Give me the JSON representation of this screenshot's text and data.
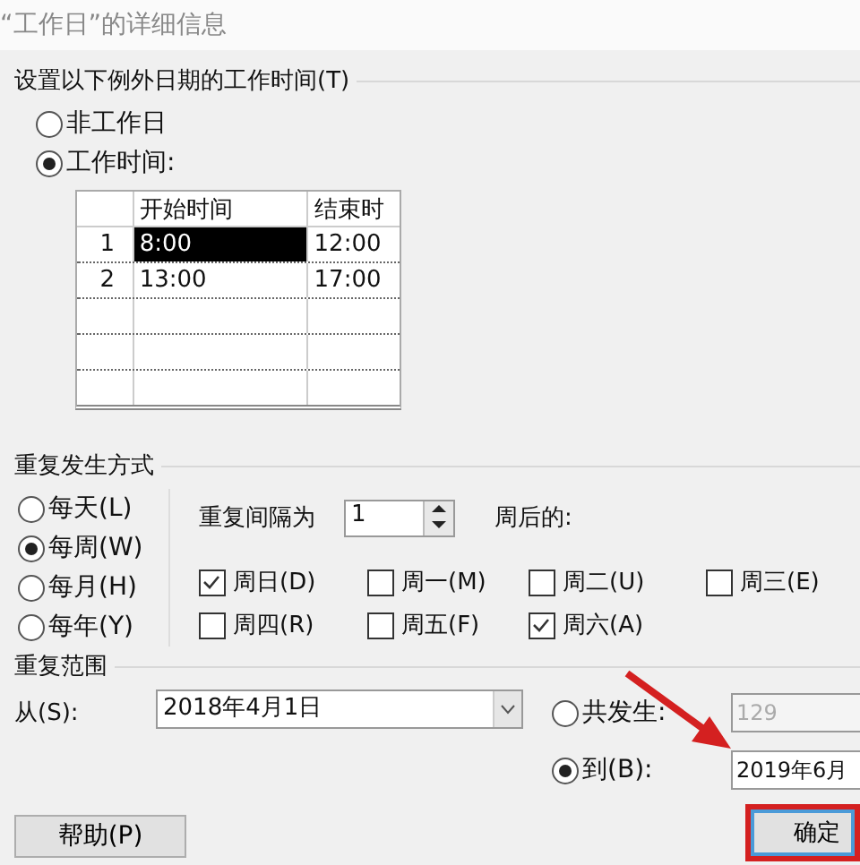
{
  "window": {
    "title": "“工作日”的详细信息"
  },
  "work_time_group": {
    "label": "设置以下例外日期的工作时间(T)",
    "options": [
      {
        "label": "非工作日",
        "selected": false
      },
      {
        "label": "工作时间:",
        "selected": true
      }
    ],
    "table": {
      "columns": [
        "开始时间",
        "结束时"
      ],
      "rows": [
        {
          "number": "1",
          "cells": [
            "8:00",
            "12:00"
          ],
          "selected": true
        },
        {
          "number": "2",
          "cells": [
            "13:00",
            "17:00"
          ],
          "selected": false
        },
        {
          "number": "",
          "cells": [
            "",
            ""
          ],
          "selected": false
        },
        {
          "number": "",
          "cells": [
            "",
            ""
          ],
          "selected": false
        },
        {
          "number": "",
          "cells": [
            "",
            ""
          ],
          "selected": false
        }
      ]
    }
  },
  "recurrence_group": {
    "label": "重复发生方式",
    "patterns": [
      {
        "label": "每天(L)",
        "selected": false
      },
      {
        "label": "每周(W)",
        "selected": true
      },
      {
        "label": "每月(H)",
        "selected": false
      },
      {
        "label": "每年(Y)",
        "selected": false
      }
    ],
    "interval_label": "重复间隔为",
    "interval_value": "1",
    "interval_suffix": "周后的:",
    "days": [
      {
        "label": "周日(D)",
        "checked": true
      },
      {
        "label": "周一(M)",
        "checked": false
      },
      {
        "label": "周二(U)",
        "checked": false
      },
      {
        "label": "周三(E)",
        "checked": false
      },
      {
        "label": "周四(R)",
        "checked": false
      },
      {
        "label": "周五(F)",
        "checked": false
      },
      {
        "label": "周六(A)",
        "checked": true
      }
    ]
  },
  "range_group": {
    "label": "重复范围",
    "from_label": "从(S):",
    "from_value": "2018年4月1日",
    "end_options": [
      {
        "label": "共发生:",
        "selected": false,
        "value": "129"
      },
      {
        "label": "到(B):",
        "selected": true,
        "value": "2019年6月"
      }
    ]
  },
  "buttons": [
    {
      "label": "帮助(P)",
      "highlighted": false
    },
    {
      "label": "确定",
      "highlighted": true
    }
  ]
}
